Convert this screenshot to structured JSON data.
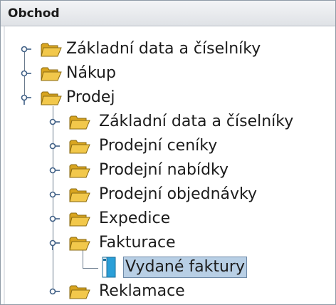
{
  "header": {
    "title": "Obchod"
  },
  "tree": {
    "nodes": [
      {
        "label": "Základní data a číselníky"
      },
      {
        "label": "Nákup"
      },
      {
        "label": "Prodej"
      },
      {
        "label": "Základní data a číselníky"
      },
      {
        "label": "Prodejní ceníky"
      },
      {
        "label": "Prodejní nabídky"
      },
      {
        "label": "Prodejní objednávky"
      },
      {
        "label": "Expedice"
      },
      {
        "label": "Fakturace"
      },
      {
        "label": "Vydané faktury"
      },
      {
        "label": "Reklamace"
      }
    ]
  },
  "icons": {
    "folder": "folder-open-icon",
    "document": "document-icon",
    "collapsed": "tree-collapsed-handle-icon",
    "expanded": "tree-expanded-handle-icon"
  },
  "colors": {
    "folder": "#e8b830",
    "selection": "#b8cfe5",
    "tree_line": "#6a7a8c"
  }
}
